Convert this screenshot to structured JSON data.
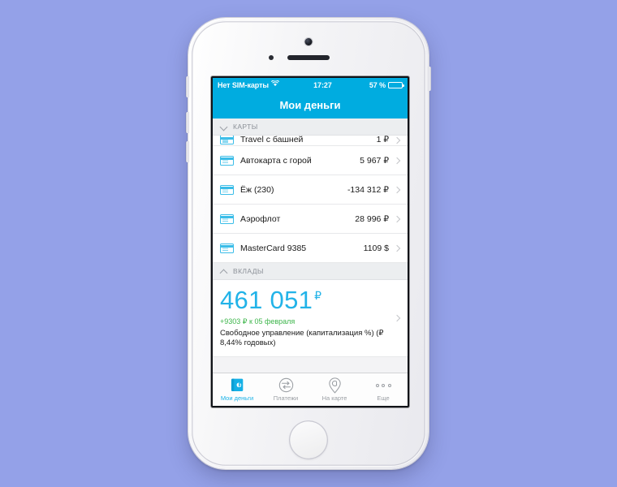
{
  "device": {
    "name": "iphone-5s-silver",
    "background_color": "#94a1e8",
    "body_color": "#f2f2f5"
  },
  "status_bar": {
    "carrier": "Нет SIM-карты",
    "wifi_icon": "wifi-icon",
    "time": "17:27",
    "battery_text": "57 %",
    "battery_level": 57,
    "background_color": "#00ace0"
  },
  "nav_bar": {
    "title": "Мои деньги",
    "background_color": "#00ace0",
    "text_color": "#ffffff"
  },
  "sections": [
    {
      "id": "cards",
      "title": "КАРТЫ",
      "chevron": "chevron-down-icon",
      "expanded": true
    },
    {
      "id": "deposits",
      "title": "ВКЛАДЫ",
      "chevron": "chevron-up-icon",
      "expanded": true
    }
  ],
  "cards": [
    {
      "name": "Travel с башней",
      "value": "1 ₽",
      "icon": "credit-card-icon",
      "clipped": true
    },
    {
      "name": "Автокарта с горой",
      "value": "5 967 ₽",
      "icon": "credit-card-icon",
      "clipped": false
    },
    {
      "name": "Ёж (230)",
      "value": "-134 312 ₽",
      "icon": "credit-card-icon",
      "clipped": false
    },
    {
      "name": "Аэрофлот",
      "value": "28 996 ₽",
      "icon": "credit-card-icon",
      "clipped": false
    },
    {
      "name": "MasterCard 9385",
      "value": "1109 $",
      "icon": "credit-card-icon",
      "clipped": false
    }
  ],
  "deposit": {
    "amount": "461 051",
    "currency": "₽",
    "amount_color": "#22b3e8",
    "delta": "+9303 ₽ к 05 февраля",
    "delta_color": "#3cb54a",
    "description": "Свободное управление (капитализация %) (₽ 8,44% годовых)"
  },
  "tab_bar": {
    "items": [
      {
        "label": "Мои деньги",
        "icon": "wallet-icon",
        "active": true
      },
      {
        "label": "Платежи",
        "icon": "transfer-icon",
        "active": false
      },
      {
        "label": "На карте",
        "icon": "map-pin-icon",
        "active": false
      },
      {
        "label": "Еще",
        "icon": "more-dots-icon",
        "active": false
      }
    ],
    "active_color": "#15b0e6",
    "inactive_color": "#9a9ea3"
  }
}
